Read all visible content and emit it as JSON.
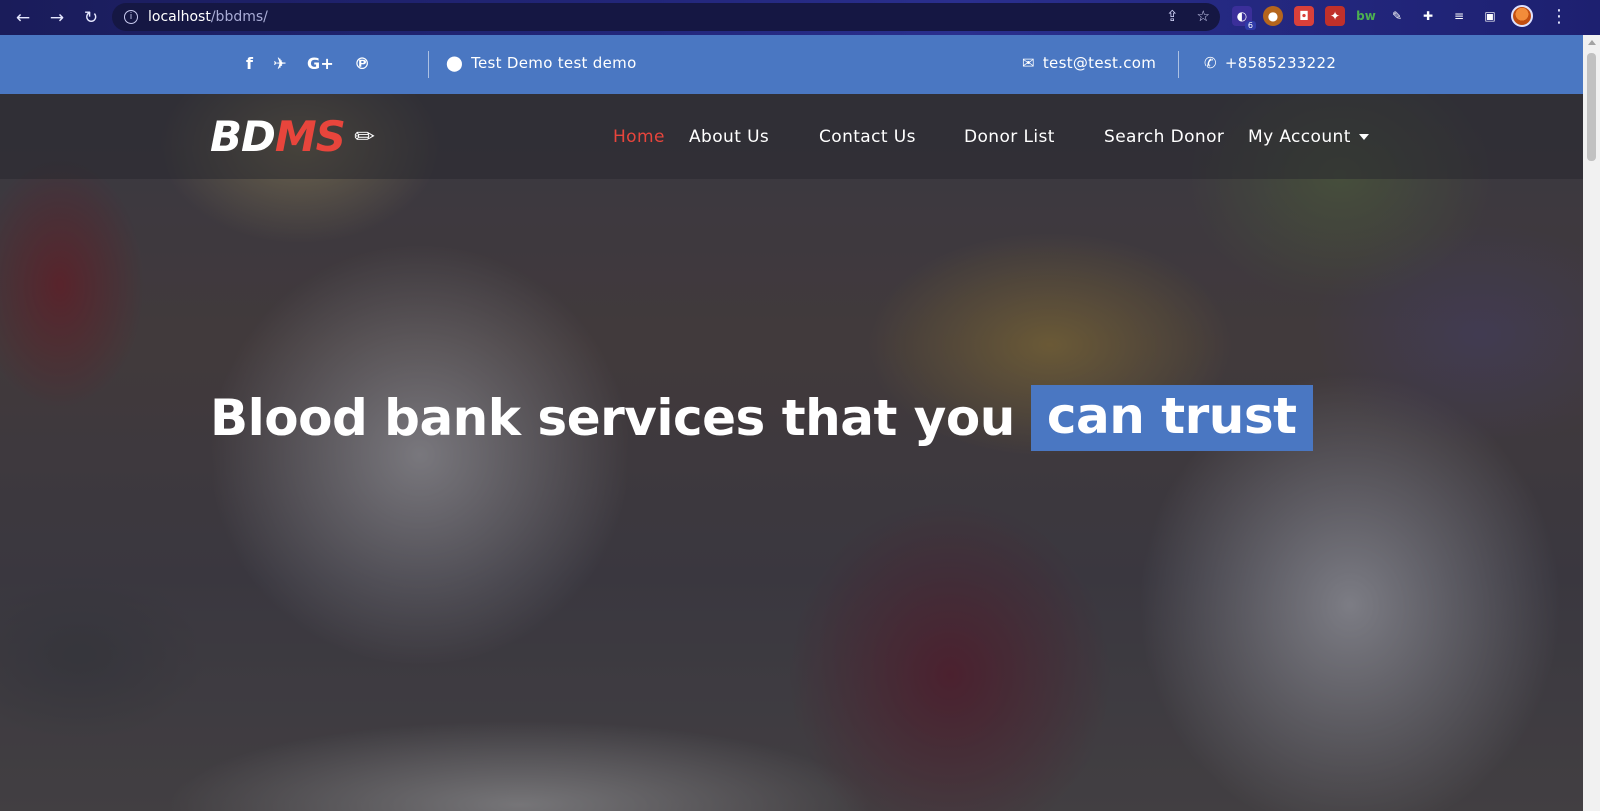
{
  "browser": {
    "url_host": "localhost",
    "url_path": "/bbdms/",
    "extension_badge": "6"
  },
  "topbar": {
    "social_icons": [
      "facebook-icon",
      "twitter-icon",
      "google-plus-icon",
      "pinterest-icon"
    ],
    "address": "Test Demo test demo",
    "email": "test@test.com",
    "phone": "+8585233222",
    "background": "#4a77c2"
  },
  "brand": {
    "part1": "BD",
    "part2": "MS",
    "accent": "#e8453c"
  },
  "nav": {
    "items": [
      {
        "label": "Home",
        "active": true
      },
      {
        "label": "About Us"
      },
      {
        "label": "Contact Us"
      },
      {
        "label": "Donor List"
      },
      {
        "label": "Search Donor"
      },
      {
        "label": "My Account"
      }
    ]
  },
  "hero": {
    "headline_main": "Blood bank services that you",
    "headline_highlight": "can trust"
  }
}
